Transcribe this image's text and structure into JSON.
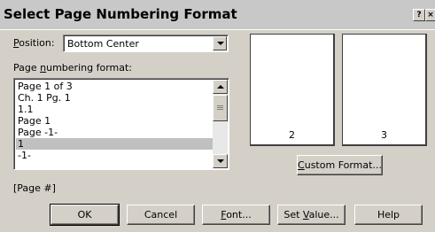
{
  "window": {
    "title": "Select Page Numbering Format",
    "help_glyph": "?",
    "close_glyph": "×"
  },
  "position": {
    "label_prefix": "",
    "label_mnemonic": "P",
    "label_rest": "osition:",
    "value": "Bottom Center"
  },
  "format": {
    "label_prefix": "Page ",
    "label_mnemonic": "n",
    "label_rest": "umbering format:",
    "items": [
      "Page 1 of  3",
      "Ch. 1 Pg. 1",
      "1.1",
      "Page 1",
      "Page -1-",
      "1",
      "-1-"
    ],
    "selected_index": 5,
    "code": "[Page #]"
  },
  "preview": {
    "left_page_number": "2",
    "right_page_number": "3"
  },
  "buttons": {
    "custom_prefix": "",
    "custom_mnemonic": "C",
    "custom_rest": "ustom Format...",
    "ok": "OK",
    "cancel": "Cancel",
    "font_prefix": "",
    "font_mnemonic": "F",
    "font_rest": "ont...",
    "setvalue_prefix": "Set ",
    "setvalue_mnemonic": "V",
    "setvalue_rest": "alue...",
    "help": "Help"
  }
}
